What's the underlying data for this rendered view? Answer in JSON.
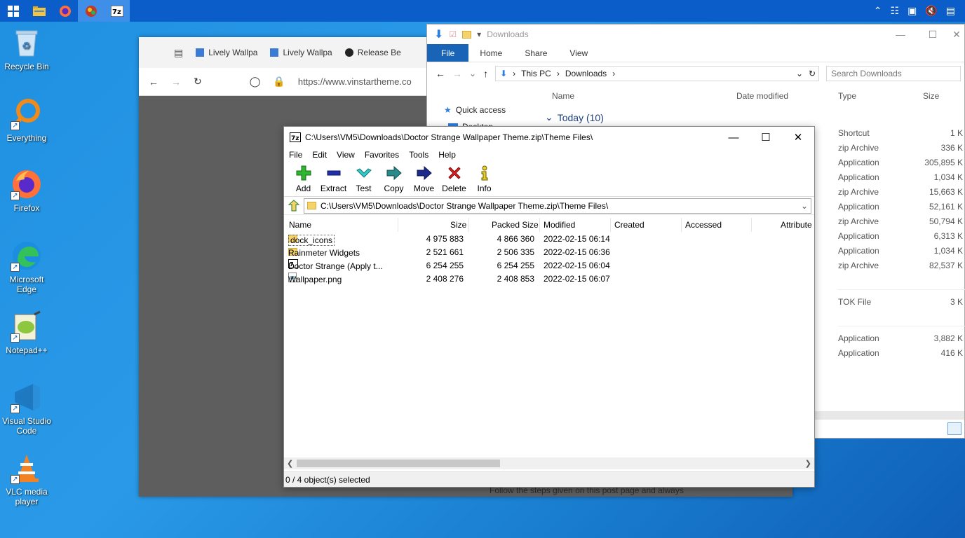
{
  "taskbar": {
    "apps": [
      "windows-logo",
      "file-explorer",
      "firefox",
      "lively-wallpaper",
      "7zip"
    ]
  },
  "desktop_icons": [
    {
      "label": "Recycle Bin",
      "icon": "recycle-bin-icon"
    },
    {
      "label": "Everything",
      "icon": "everything-search-icon"
    },
    {
      "label": "Firefox",
      "icon": "firefox-icon"
    },
    {
      "label": "Microsoft Edge",
      "icon": "edge-icon"
    },
    {
      "label": "Notepad++",
      "icon": "notepadpp-icon"
    },
    {
      "label": "Visual Studio Code",
      "icon": "vscode-icon"
    },
    {
      "label": "VLC media player",
      "icon": "vlc-icon"
    }
  ],
  "browser": {
    "tabs": [
      "Lively Wallpa",
      "Lively Wallpa",
      "Release Be"
    ],
    "url": "https://www.vinstartheme.co",
    "footer_text": "Follow the steps given on this post page and always"
  },
  "explorer": {
    "title": "Downloads",
    "ribbon": {
      "file": "File",
      "home": "Home",
      "share": "Share",
      "view": "View"
    },
    "breadcrumb": [
      "This PC",
      "Downloads"
    ],
    "search_placeholder": "Search Downloads",
    "columns": {
      "name": "Name",
      "date": "Date modified",
      "type": "Type",
      "size": "Size"
    },
    "nav": {
      "quick_access": "Quick access",
      "desktop": "Desktop"
    },
    "group": "Today (10)",
    "rows": [
      {
        "type": "Shortcut",
        "size": "1 K"
      },
      {
        "type": "zip Archive",
        "size": "336 K"
      },
      {
        "type": "Application",
        "size": "305,895 K"
      },
      {
        "type": "Application",
        "size": "1,034 K"
      },
      {
        "type": "zip Archive",
        "size": "15,663 K"
      },
      {
        "type": "Application",
        "size": "52,161 K"
      },
      {
        "type": "zip Archive",
        "size": "50,794 K"
      },
      {
        "type": "Application",
        "size": "6,313 K"
      },
      {
        "type": "Application",
        "size": "1,034 K"
      },
      {
        "type": "zip Archive",
        "size": "82,537 K"
      }
    ],
    "rows2": [
      {
        "type": "TOK File",
        "size": "3 K"
      }
    ],
    "rows3": [
      {
        "type": "Application",
        "size": "3,882 K"
      },
      {
        "type": "Application",
        "size": "416 K"
      }
    ]
  },
  "sevenzip": {
    "title": "C:\\Users\\VM5\\Downloads\\Doctor Strange Wallpaper Theme.zip\\Theme Files\\",
    "menu": [
      "File",
      "Edit",
      "View",
      "Favorites",
      "Tools",
      "Help"
    ],
    "toolbar": [
      "Add",
      "Extract",
      "Test",
      "Copy",
      "Move",
      "Delete",
      "Info"
    ],
    "path": "C:\\Users\\VM5\\Downloads\\Doctor Strange Wallpaper Theme.zip\\Theme Files\\",
    "columns": {
      "name": "Name",
      "size": "Size",
      "packed": "Packed Size",
      "modified": "Modified",
      "created": "Created",
      "accessed": "Accessed",
      "attributes": "Attribute"
    },
    "rows": [
      {
        "name": "dock_icons",
        "size": "4 975 883",
        "packed": "4 866 360",
        "modified": "2022-02-15 06:14",
        "icon": "folder-icon"
      },
      {
        "name": "Rainmeter Widgets",
        "size": "2 521 661",
        "packed": "2 506 335",
        "modified": "2022-02-15 06:36",
        "icon": "folder-icon"
      },
      {
        "name": "Doctor Strange (Apply t...",
        "size": "6 254 255",
        "packed": "6 254 255",
        "modified": "2022-02-15 06:04",
        "icon": "7z-archive-icon"
      },
      {
        "name": "Wallpaper.png",
        "size": "2 408 276",
        "packed": "2 408 853",
        "modified": "2022-02-15 06:07",
        "icon": "image-file-icon"
      }
    ],
    "status": "0 / 4 object(s) selected"
  }
}
